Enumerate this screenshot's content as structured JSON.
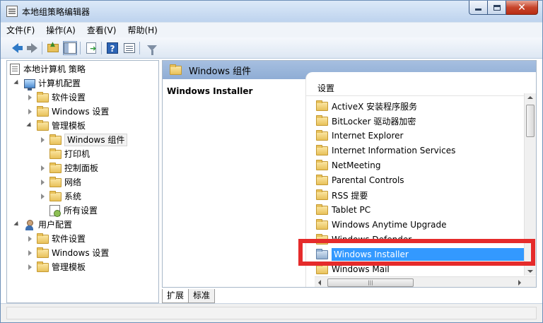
{
  "window": {
    "title": "本地组策略编辑器",
    "close_glyph": "✕"
  },
  "menu": [
    {
      "label": "文件(F)"
    },
    {
      "label": "操作(A)"
    },
    {
      "label": "查看(V)"
    },
    {
      "label": "帮助(H)"
    }
  ],
  "toolbar": {
    "icons": [
      "back-arrow-icon",
      "forward-arrow-icon",
      "folder-up-icon",
      "show-hide-tree-icon",
      "export-list-icon",
      "help-icon",
      "properties-icon",
      "filter-icon"
    ]
  },
  "tree": {
    "root": "本地计算机 策略",
    "computer_config": "计算机配置",
    "cc_software": "软件设置",
    "cc_windows": "Windows 设置",
    "cc_admin": "管理模板",
    "cc_components": "Windows 组件",
    "cc_printers": "打印机",
    "cc_control_panel": "控制面板",
    "cc_network": "网络",
    "cc_system": "系统",
    "cc_all_settings": "所有设置",
    "user_config": "用户配置",
    "uc_software": "软件设置",
    "uc_windows": "Windows 设置",
    "uc_admin": "管理模板"
  },
  "details": {
    "header_title": "Windows 组件",
    "selected_title": "Windows Installer",
    "column_header": "设置",
    "items": [
      "ActiveX 安装程序服务",
      "BitLocker 驱动器加密",
      "Internet Explorer",
      "Internet Information Services",
      "NetMeeting",
      "Parental Controls",
      "RSS 提要",
      "Tablet PC",
      "Windows Anytime Upgrade",
      "Windows Defender",
      "Windows Installer",
      "Windows Mail"
    ],
    "selected_index": 10,
    "hscroll_grip": "|||"
  },
  "tabs": [
    {
      "label": "扩展"
    },
    {
      "label": "标准"
    }
  ],
  "colors": {
    "selection": "#3399ff",
    "highlight_box": "#e52b2b",
    "pane_header": "#8fadd5"
  }
}
